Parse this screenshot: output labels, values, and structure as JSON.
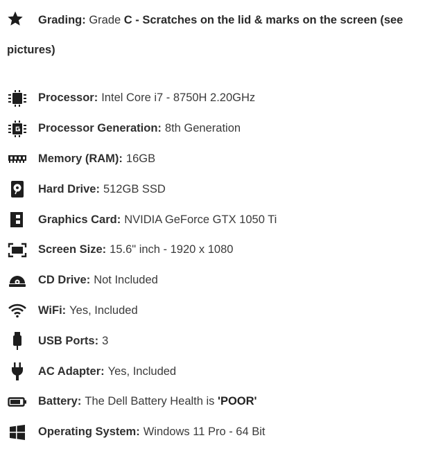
{
  "grading": {
    "label": "Grading:",
    "grade_prefix": "Grade",
    "grade_text": "C - Scratches on the lid & marks on the screen (see pictures)"
  },
  "specs": [
    {
      "icon": "cpu-icon",
      "label": "Processor:",
      "value": "Intel Core i7 - 8750H 2.20GHz"
    },
    {
      "icon": "cpu-generation-icon",
      "label": "Processor Generation:",
      "value": "8th Generation"
    },
    {
      "icon": "memory-icon",
      "label": "Memory (RAM):",
      "value": "16GB"
    },
    {
      "icon": "hard-drive-icon",
      "label": "Hard Drive:",
      "value": "512GB SSD"
    },
    {
      "icon": "graphics-card-icon",
      "label": "Graphics Card:",
      "value": "NVIDIA GeForce GTX 1050 Ti"
    },
    {
      "icon": "screen-size-icon",
      "label": "Screen Size:",
      "value": "15.6\" inch - 1920 x 1080"
    },
    {
      "icon": "cd-drive-icon",
      "label": "CD Drive:",
      "value": "Not Included"
    },
    {
      "icon": "wifi-icon",
      "label": "WiFi:",
      "value": "Yes, Included"
    },
    {
      "icon": "usb-icon",
      "label": "USB Ports:",
      "value": "3"
    },
    {
      "icon": "ac-adapter-icon",
      "label": "AC Adapter:",
      "value": "Yes, Included"
    },
    {
      "icon": "battery-icon",
      "label": "Battery:",
      "value": "The Dell Battery Health is",
      "value_emphasis": "'POOR'"
    },
    {
      "icon": "windows-icon",
      "label": "Operating System:",
      "value": "Windows 11 Pro - 64 Bit"
    }
  ]
}
